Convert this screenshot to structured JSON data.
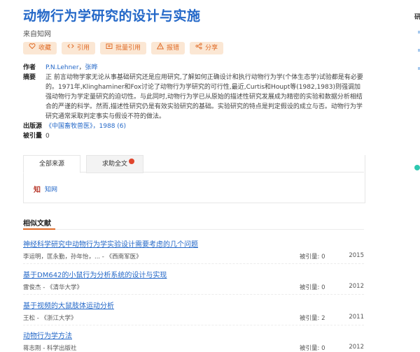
{
  "article": {
    "title": "动物行为学研究的设计与实施",
    "source": "来自知网"
  },
  "actions": [
    {
      "label": "收藏",
      "icon": "heart-icon"
    },
    {
      "label": "引用",
      "icon": "code-icon"
    },
    {
      "label": "批量引用",
      "icon": "batch-icon"
    },
    {
      "label": "报错",
      "icon": "warning-icon"
    },
    {
      "label": "分享",
      "icon": "share-icon"
    }
  ],
  "meta": {
    "author_label": "作者",
    "authors": [
      {
        "name": "P.N.Lehner"
      },
      {
        "name": "张晔"
      }
    ],
    "author_sep": "，",
    "abstract_label": "摘要",
    "abstract": "正 前言动物学家无论从事基础研究还是应用研究,了解如何正确设计和执行动物行为学(个体生态学)试验都是有必要的。1971年,Klinghaminer和Fox讨论了动物行为学研究的可行性,最近,Curtis和Houpt等(1982,1983)则强调加强动物行为学定量研究的迫切性。与此同时,动物行为学已从原始的描述性研究发展成为精密的实验和数据分析相结合的严谨的科学。然而,描述性研究仍是有效实验研究的基础。实验研究的特点是判定假设的成立与否。动物行为学研究通常采取判定事实与假设不符的做法。",
    "pub_label": "出版源",
    "pub_journal": "《中国畜牧兽医》",
    "pub_detail": "，1988 (6)",
    "cited_label": "被引量",
    "cited_value": "0"
  },
  "sources": {
    "tab_all": "全部来源",
    "tab_help": "求助全文",
    "tab_badge": "",
    "item_logo": "知",
    "item_label": "知网"
  },
  "related": {
    "heading": "相似文献",
    "items": [
      {
        "title": "神经科学研究中动物行为学实验设计需要考虑的几个问题",
        "authors": "李运明，匡永勤，孙年怡，... - 《西南军医》",
        "cited": "被引量: 0",
        "year": "2015"
      },
      {
        "title": "基于DM642的小鼠行为分析系统的设计与实现",
        "authors": "雷俊杰 - 《清华大学》",
        "cited": "被引量: 0",
        "year": "2012"
      },
      {
        "title": "基于视频的大鼠肢体运动分析",
        "authors": "王松 - 《浙江大学》",
        "cited": "被引量: 2",
        "year": "2011"
      },
      {
        "title": "动物行为学方法",
        "authors": "蒋志刚 - 科学出版社",
        "cited": "被引量: 0",
        "year": "2012"
      }
    ]
  },
  "sidebar": {
    "title": "研"
  },
  "colors": {
    "accent": "#2468c8",
    "orange": "#e06c28",
    "orange_bg": "#fbe7d4",
    "teal": "#2ec8b0"
  }
}
